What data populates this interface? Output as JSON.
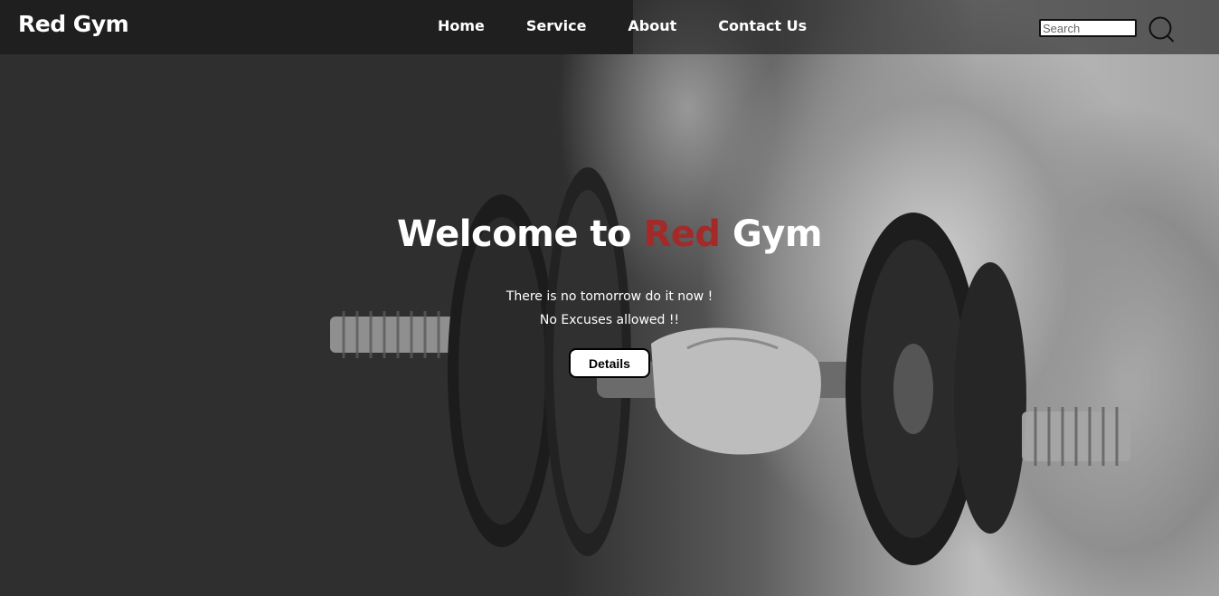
{
  "brand": {
    "name": "Red Gym"
  },
  "nav": {
    "links": [
      {
        "label": "Home"
      },
      {
        "label": "Service"
      },
      {
        "label": "About"
      },
      {
        "label": "Contact Us"
      }
    ]
  },
  "search": {
    "placeholder": "Search",
    "icon": "search-icon"
  },
  "hero": {
    "title_prefix": "Welcome to ",
    "title_accent": "Red",
    "title_suffix": " Gym",
    "line1": "There is no tomorrow do it now !",
    "line2": "No Excuses allowed !!",
    "button_label": "Details",
    "background_image": "dumbbell-curl-photo"
  },
  "colors": {
    "accent": "#a42a2a",
    "nav_background": "#1f1f1f",
    "page_background": "#2f2f2f"
  }
}
